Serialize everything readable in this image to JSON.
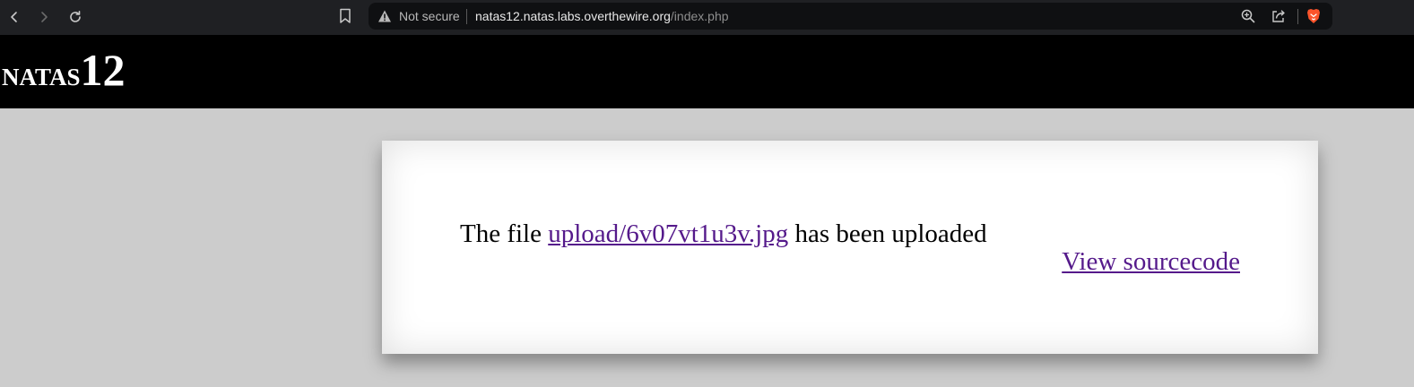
{
  "browser": {
    "security_label": "Not secure",
    "url_host": "natas12.natas.labs.overthewire.org",
    "url_path": "/index.php"
  },
  "header": {
    "logo_word": "natas",
    "logo_number": "12"
  },
  "content": {
    "message_prefix": "The file ",
    "file_link": "upload/6v07vt1u3v.jpg",
    "message_suffix": " has been uploaded",
    "source_link": "View sourcecode"
  },
  "colors": {
    "page_bg": "#cccccc",
    "header_bg": "#000000",
    "link": "#551a8b"
  }
}
